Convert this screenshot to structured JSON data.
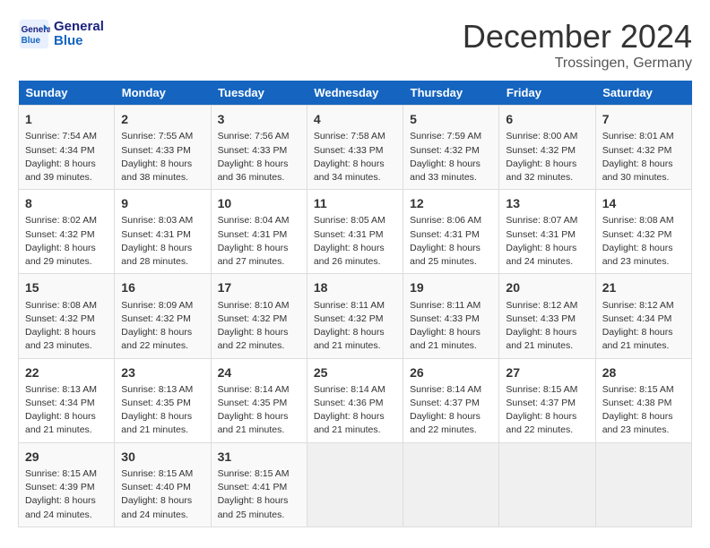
{
  "header": {
    "logo_line1": "General",
    "logo_line2": "Blue",
    "month_title": "December 2024",
    "location": "Trossingen, Germany"
  },
  "days_of_week": [
    "Sunday",
    "Monday",
    "Tuesday",
    "Wednesday",
    "Thursday",
    "Friday",
    "Saturday"
  ],
  "weeks": [
    [
      {
        "day": "1",
        "sunrise": "7:54 AM",
        "sunset": "4:34 PM",
        "daylight": "8 hours and 39 minutes."
      },
      {
        "day": "2",
        "sunrise": "7:55 AM",
        "sunset": "4:33 PM",
        "daylight": "8 hours and 38 minutes."
      },
      {
        "day": "3",
        "sunrise": "7:56 AM",
        "sunset": "4:33 PM",
        "daylight": "8 hours and 36 minutes."
      },
      {
        "day": "4",
        "sunrise": "7:58 AM",
        "sunset": "4:33 PM",
        "daylight": "8 hours and 34 minutes."
      },
      {
        "day": "5",
        "sunrise": "7:59 AM",
        "sunset": "4:32 PM",
        "daylight": "8 hours and 33 minutes."
      },
      {
        "day": "6",
        "sunrise": "8:00 AM",
        "sunset": "4:32 PM",
        "daylight": "8 hours and 32 minutes."
      },
      {
        "day": "7",
        "sunrise": "8:01 AM",
        "sunset": "4:32 PM",
        "daylight": "8 hours and 30 minutes."
      }
    ],
    [
      {
        "day": "8",
        "sunrise": "8:02 AM",
        "sunset": "4:32 PM",
        "daylight": "8 hours and 29 minutes."
      },
      {
        "day": "9",
        "sunrise": "8:03 AM",
        "sunset": "4:31 PM",
        "daylight": "8 hours and 28 minutes."
      },
      {
        "day": "10",
        "sunrise": "8:04 AM",
        "sunset": "4:31 PM",
        "daylight": "8 hours and 27 minutes."
      },
      {
        "day": "11",
        "sunrise": "8:05 AM",
        "sunset": "4:31 PM",
        "daylight": "8 hours and 26 minutes."
      },
      {
        "day": "12",
        "sunrise": "8:06 AM",
        "sunset": "4:31 PM",
        "daylight": "8 hours and 25 minutes."
      },
      {
        "day": "13",
        "sunrise": "8:07 AM",
        "sunset": "4:31 PM",
        "daylight": "8 hours and 24 minutes."
      },
      {
        "day": "14",
        "sunrise": "8:08 AM",
        "sunset": "4:32 PM",
        "daylight": "8 hours and 23 minutes."
      }
    ],
    [
      {
        "day": "15",
        "sunrise": "8:08 AM",
        "sunset": "4:32 PM",
        "daylight": "8 hours and 23 minutes."
      },
      {
        "day": "16",
        "sunrise": "8:09 AM",
        "sunset": "4:32 PM",
        "daylight": "8 hours and 22 minutes."
      },
      {
        "day": "17",
        "sunrise": "8:10 AM",
        "sunset": "4:32 PM",
        "daylight": "8 hours and 22 minutes."
      },
      {
        "day": "18",
        "sunrise": "8:11 AM",
        "sunset": "4:32 PM",
        "daylight": "8 hours and 21 minutes."
      },
      {
        "day": "19",
        "sunrise": "8:11 AM",
        "sunset": "4:33 PM",
        "daylight": "8 hours and 21 minutes."
      },
      {
        "day": "20",
        "sunrise": "8:12 AM",
        "sunset": "4:33 PM",
        "daylight": "8 hours and 21 minutes."
      },
      {
        "day": "21",
        "sunrise": "8:12 AM",
        "sunset": "4:34 PM",
        "daylight": "8 hours and 21 minutes."
      }
    ],
    [
      {
        "day": "22",
        "sunrise": "8:13 AM",
        "sunset": "4:34 PM",
        "daylight": "8 hours and 21 minutes."
      },
      {
        "day": "23",
        "sunrise": "8:13 AM",
        "sunset": "4:35 PM",
        "daylight": "8 hours and 21 minutes."
      },
      {
        "day": "24",
        "sunrise": "8:14 AM",
        "sunset": "4:35 PM",
        "daylight": "8 hours and 21 minutes."
      },
      {
        "day": "25",
        "sunrise": "8:14 AM",
        "sunset": "4:36 PM",
        "daylight": "8 hours and 21 minutes."
      },
      {
        "day": "26",
        "sunrise": "8:14 AM",
        "sunset": "4:37 PM",
        "daylight": "8 hours and 22 minutes."
      },
      {
        "day": "27",
        "sunrise": "8:15 AM",
        "sunset": "4:37 PM",
        "daylight": "8 hours and 22 minutes."
      },
      {
        "day": "28",
        "sunrise": "8:15 AM",
        "sunset": "4:38 PM",
        "daylight": "8 hours and 23 minutes."
      }
    ],
    [
      {
        "day": "29",
        "sunrise": "8:15 AM",
        "sunset": "4:39 PM",
        "daylight": "8 hours and 24 minutes."
      },
      {
        "day": "30",
        "sunrise": "8:15 AM",
        "sunset": "4:40 PM",
        "daylight": "8 hours and 24 minutes."
      },
      {
        "day": "31",
        "sunrise": "8:15 AM",
        "sunset": "4:41 PM",
        "daylight": "8 hours and 25 minutes."
      },
      null,
      null,
      null,
      null
    ]
  ]
}
